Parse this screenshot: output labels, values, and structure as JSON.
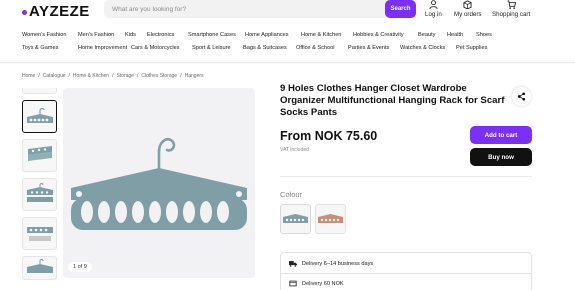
{
  "brand": {
    "logo": "AYZEZE",
    "accent": "#7b2ff7"
  },
  "search": {
    "placeholder": "What are you looking for?",
    "button": "Search"
  },
  "header_actions": {
    "login": "Log in",
    "orders": "My orders",
    "cart": "Shopping cart"
  },
  "nav": {
    "row1": [
      "Women's Fashion",
      "Men's Fashion",
      "Kids",
      "Electronics",
      "Smartphone Cases",
      "Home Appliances",
      "Home & Kitchen",
      "Hobbies & Creativity",
      "Beauty",
      "Health",
      "Shoes"
    ],
    "row2": [
      "Toys & Games",
      "Home Improvement",
      "Cars & Motorcycles",
      "Sport & Leisure",
      "Bags & Suitcases",
      "Office & School",
      "Parties & Events",
      "Watches & Clocks",
      "Pet Supplies"
    ]
  },
  "breadcrumb": [
    "Home",
    "/",
    "Catalogue",
    "/",
    "Home & Kitchen",
    "/",
    "Storage",
    "/",
    "Clothes Storage",
    "/",
    "Hangers"
  ],
  "gallery": {
    "counter": "1 of 9",
    "product_color": "#7f9ea6"
  },
  "product": {
    "title": "9 Holes Clothes Hanger Closet Wardrobe Organizer Multifunctional Hanging Rack for Scarf Socks Pants",
    "price": "From NOK 75.60",
    "vat": "VAT included",
    "add_to_cart": "Add to cart",
    "buy_now": "Buy now",
    "color_label": "Colour",
    "colors": [
      "#7f9ea6",
      "#c98f76"
    ]
  },
  "delivery": {
    "time": "Delivery 6–14 business days",
    "cost": "Delivery 60 NOK"
  }
}
